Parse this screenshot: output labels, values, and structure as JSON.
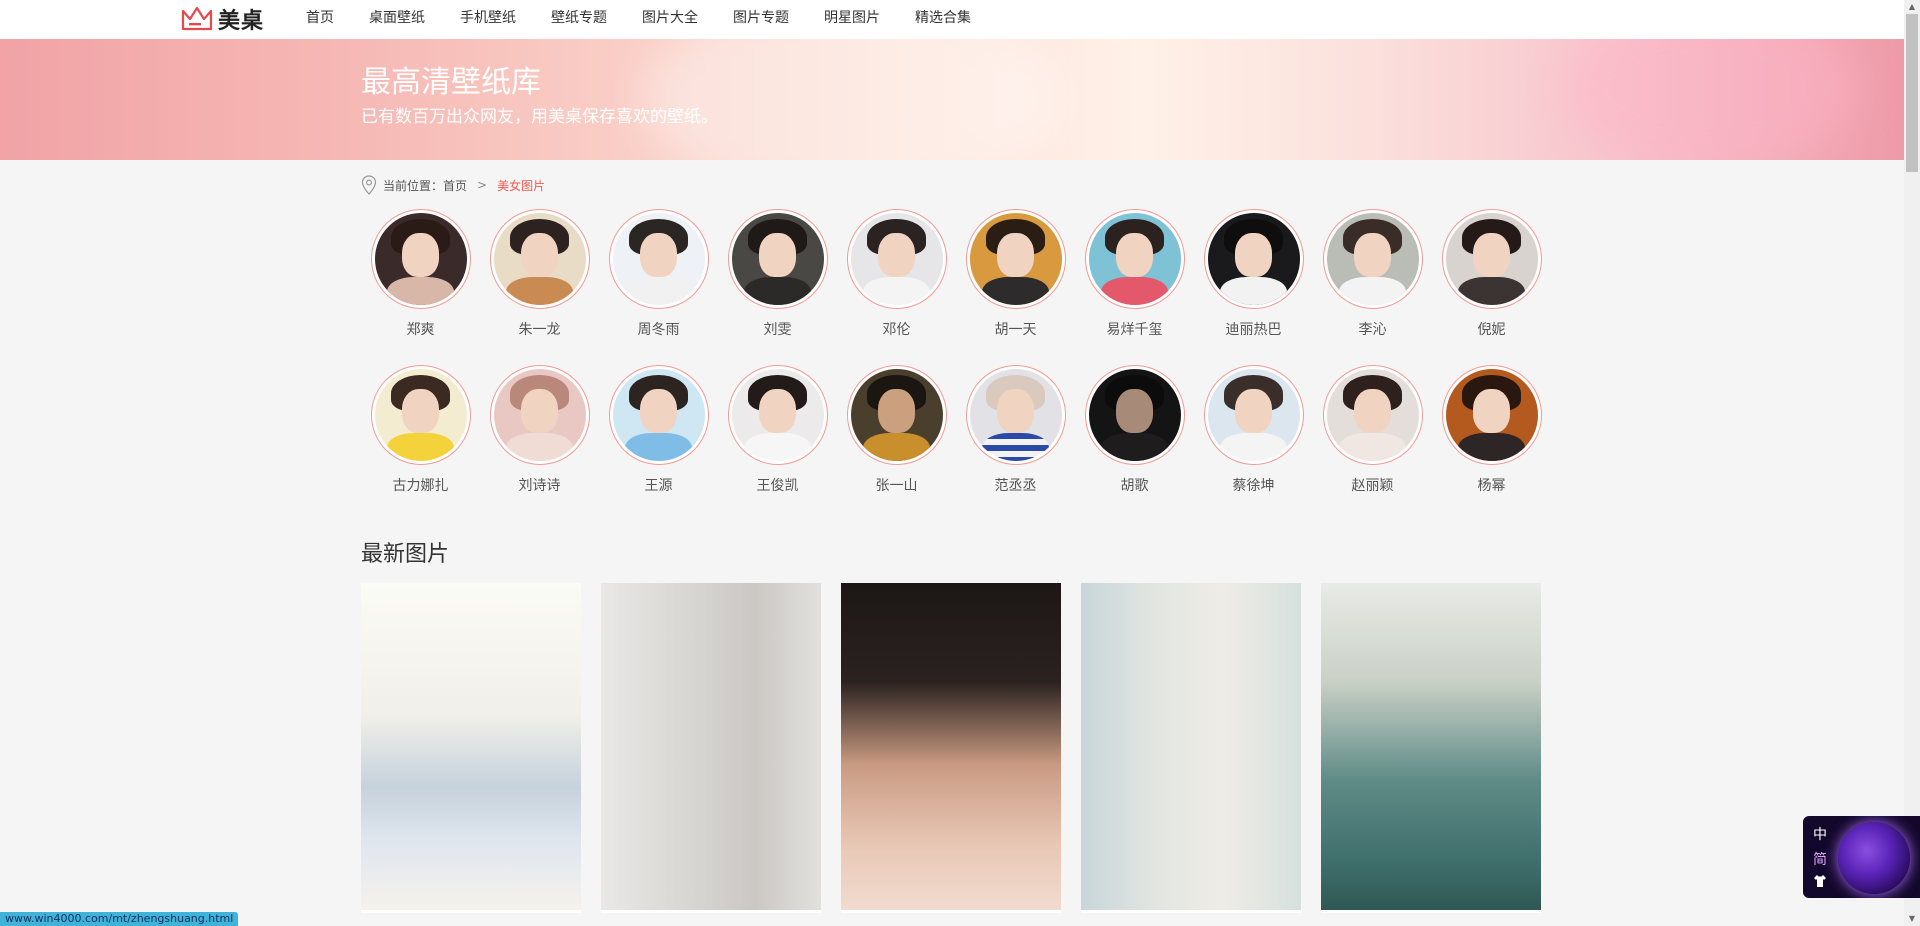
{
  "header": {
    "logo_text": "美桌",
    "nav": [
      "首页",
      "桌面壁纸",
      "手机壁纸",
      "壁纸专题",
      "图片大全",
      "图片专题",
      "明星图片",
      "精选合集"
    ]
  },
  "banner": {
    "title": "最高清壁纸库",
    "subtitle": "已有数百万出众网友，用美桌保存喜欢的壁纸。"
  },
  "breadcrumb": {
    "prefix": "当前位置：",
    "home": "首页",
    "separator": ">",
    "current": "美女图片"
  },
  "stars": {
    "row1": [
      "郑爽",
      "朱一龙",
      "周冬雨",
      "刘雯",
      "邓伦",
      "胡一天",
      "易烊千玺",
      "迪丽热巴",
      "李沁",
      "倪妮"
    ],
    "row2": [
      "古力娜扎",
      "刘诗诗",
      "王源",
      "王俊凯",
      "张一山",
      "范丞丞",
      "胡歌",
      "蔡徐坤",
      "赵丽颖",
      "杨幂"
    ]
  },
  "latest": {
    "title": "最新图片",
    "photo_count": 5
  },
  "status_bar": {
    "url": "www.win4000.com/mt/zhengshuang.html"
  },
  "lang_widget": {
    "traditional": "中",
    "simplified": "简"
  },
  "colors": {
    "accent": "#f0584f",
    "ring": "#f29a95",
    "status_bg": "#3fb3d9"
  }
}
